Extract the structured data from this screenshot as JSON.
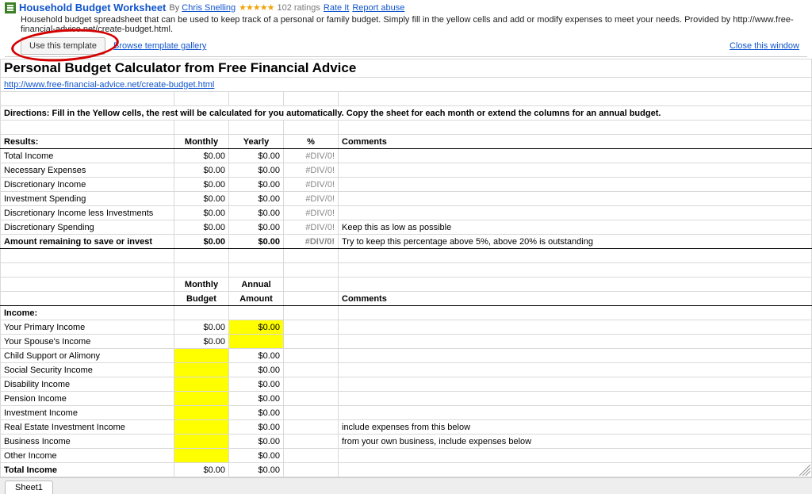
{
  "header": {
    "title": "Household Budget Worksheet",
    "by": "By",
    "author": "Chris Snelling",
    "stars": "★★★★★",
    "ratings": "102 ratings",
    "rate_it": "Rate It",
    "report": "Report abuse",
    "description": "Household budget spreadsheet that can be used to keep track of a personal or family budget. Simply fill in the yellow cells and add or modify expenses to meet your needs. Provided by http://www.free-financial-advice.net/create-budget.html.",
    "use_template": "Use this template",
    "browse": "Browse template gallery",
    "close": "Close this window"
  },
  "sheet": {
    "page_title": "Personal Budget Calculator from Free Financial Advice",
    "url": "http://www.free-financial-advice.net/create-budget.html",
    "directions": "Directions: Fill in the Yellow cells, the rest will be calculated for you automatically. Copy the sheet for each month or extend the columns for an annual budget.",
    "results": {
      "heading": "Results:",
      "cols": {
        "monthly": "Monthly",
        "yearly": "Yearly",
        "pct": "%",
        "comments": "Comments"
      },
      "rows": [
        {
          "label": "Total Income",
          "m": "$0.00",
          "y": "$0.00",
          "p": "#DIV/0!",
          "c": ""
        },
        {
          "label": "Necessary Expenses",
          "m": "$0.00",
          "y": "$0.00",
          "p": "#DIV/0!",
          "c": ""
        },
        {
          "label": "Discretionary Income",
          "m": "$0.00",
          "y": "$0.00",
          "p": "#DIV/0!",
          "c": ""
        },
        {
          "label": "Investment Spending",
          "m": "$0.00",
          "y": "$0.00",
          "p": "#DIV/0!",
          "c": ""
        },
        {
          "label": "Discretionary Income less Investments",
          "m": "$0.00",
          "y": "$0.00",
          "p": "#DIV/0!",
          "c": ""
        },
        {
          "label": "Discretionary Spending",
          "m": "$0.00",
          "y": "$0.00",
          "p": "#DIV/0!",
          "c": "Keep this as low as possible"
        },
        {
          "label": "Amount remaining to save or invest",
          "m": "$0.00",
          "y": "$0.00",
          "p": "#DIV/0!",
          "c": "Try to keep this percentage above 5%, above 20% is outstanding"
        }
      ]
    },
    "income": {
      "cols": {
        "mb": "Monthly Budget",
        "aa": "Annual Amount",
        "comments": "Comments"
      },
      "heading": "Income:",
      "rows": [
        {
          "label": "Your Primary Income",
          "m": "$0.00",
          "a": "$0.00",
          "c": "",
          "ym": false,
          "ya": true
        },
        {
          "label": "Your Spouse's Income",
          "m": "$0.00",
          "a": "",
          "c": "",
          "ym": false,
          "ya": true
        },
        {
          "label": "Child Support or Alimony",
          "m": "",
          "a": "$0.00",
          "c": "",
          "ym": true,
          "ya": false
        },
        {
          "label": "Social Security Income",
          "m": "",
          "a": "$0.00",
          "c": "",
          "ym": true,
          "ya": false
        },
        {
          "label": "Disability Income",
          "m": "",
          "a": "$0.00",
          "c": "",
          "ym": true,
          "ya": false
        },
        {
          "label": "Pension Income",
          "m": "",
          "a": "$0.00",
          "c": "",
          "ym": true,
          "ya": false
        },
        {
          "label": "Investment Income",
          "m": "",
          "a": "$0.00",
          "c": "",
          "ym": true,
          "ya": false
        },
        {
          "label": "Real Estate Investment Income",
          "m": "",
          "a": "$0.00",
          "c": "include expenses from this below",
          "ym": true,
          "ya": false
        },
        {
          "label": "Business Income",
          "m": "",
          "a": "$0.00",
          "c": "from your own business, include expenses below",
          "ym": true,
          "ya": false
        },
        {
          "label": "Other Income",
          "m": "",
          "a": "$0.00",
          "c": "",
          "ym": true,
          "ya": false
        }
      ],
      "total": {
        "label": "Total Income",
        "m": "$0.00",
        "a": "$0.00"
      }
    }
  },
  "tab": "Sheet1"
}
